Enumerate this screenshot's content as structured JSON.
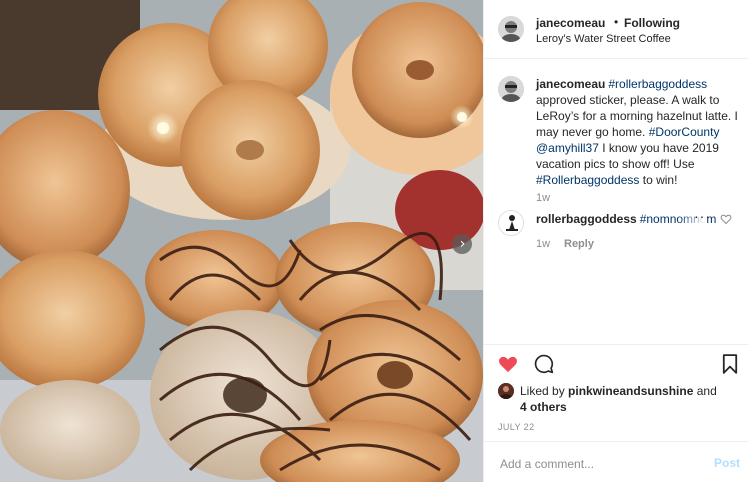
{
  "header": {
    "username": "janecomeau",
    "separator": "•",
    "follow_label": "Following",
    "location": "Leroy's Water Street Coffee"
  },
  "caption": {
    "username": "janecomeau",
    "hashtag1": "#rollerbaggoddess",
    "text1": " approved sticker, please. A walk to LeRoy’s for a morning hazelnut latte. I may never go home. ",
    "hashtag2": "#DoorCounty",
    "mention": "@amyhill37",
    "text2": " I know you have 2019 vacation pics to show off! Use ",
    "hashtag3": "#Rollerbaggoddess",
    "text3": " to win!",
    "time": "1w"
  },
  "comment": {
    "username": "rollerbaggoddess",
    "hashtag": "#nomnomnom",
    "more": "···",
    "time": "1w",
    "reply_label": "Reply"
  },
  "likes": {
    "prefix": "Liked by ",
    "user": "pinkwineandsunshine",
    "suffix": " and",
    "others": "4 others"
  },
  "date": "JULY 22",
  "add_comment": {
    "placeholder": "Add a comment...",
    "post_label": "Post"
  },
  "colors": {
    "heart": "#ed4956",
    "link": "#003569",
    "muted": "#8e8e8e",
    "post_disabled": "#b2dffc"
  },
  "icons": {
    "like": "heart-filled-icon",
    "comment": "comment-bubble-icon",
    "save": "bookmark-icon",
    "next": "chevron-right-icon",
    "comment_like": "heart-outline-icon"
  },
  "photo": {
    "subject": "photo of bagels and chocolate-drizzled donuts in a pastry case"
  }
}
